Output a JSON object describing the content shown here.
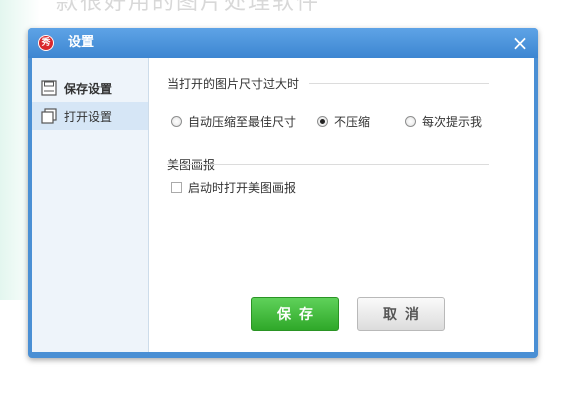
{
  "background": {
    "heading": "款很好用的图片处理软件"
  },
  "dialog": {
    "title": "设置",
    "logo_text": "秀",
    "close_glyph": "×"
  },
  "sidebar": {
    "items": [
      {
        "label": "保存设置",
        "icon": "save-icon",
        "active": false
      },
      {
        "label": "打开设置",
        "icon": "copy-icon",
        "active": true
      }
    ]
  },
  "open_settings": {
    "size_section": {
      "title": "当打开的图片尺寸过大时",
      "options": [
        {
          "label": "自动压缩至最佳尺寸",
          "checked": false
        },
        {
          "label": "不压缩",
          "checked": true
        },
        {
          "label": "每次提示我",
          "checked": false
        }
      ]
    },
    "poster_section": {
      "title": "美图画报",
      "checkbox_label": "启动时打开美图画报",
      "checked": false
    }
  },
  "buttons": {
    "save_label": "保存",
    "cancel_label": "取消"
  },
  "colors": {
    "title_bar": "#4a8fd4",
    "save_button": "#3cb935",
    "sidebar_active": "#d6e6f6"
  }
}
